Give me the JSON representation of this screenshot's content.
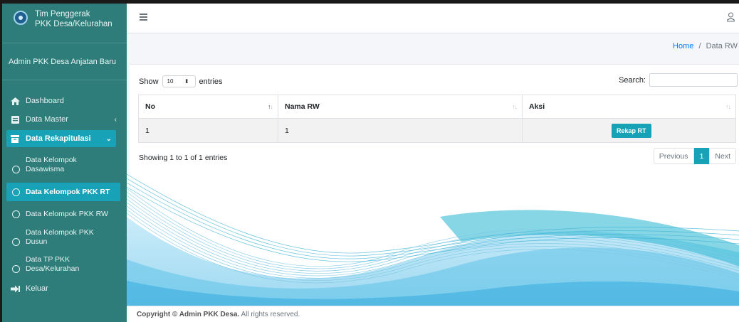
{
  "brand": {
    "line1": "Tim Penggerak",
    "line2": "PKK Desa/Kelurahan"
  },
  "user": {
    "name": "Admin PKK Desa Anjatan Baru"
  },
  "sidebar": {
    "items": [
      {
        "label": "Dashboard",
        "icon": "home-icon"
      },
      {
        "label": "Data Master",
        "icon": "database-icon"
      },
      {
        "label": "Data Rekapitulasi",
        "icon": "archive-icon"
      }
    ],
    "sub": [
      {
        "line1": "Data Kelompok",
        "line2": "Dasawisma"
      },
      {
        "label": "Data Kelompok PKK RT"
      },
      {
        "label": "Data Kelompok PKK RW"
      },
      {
        "line1": "Data Kelompok PKK",
        "line2": "Dusun"
      },
      {
        "line1": "Data TP PKK",
        "line2": "Desa/Kelurahan"
      }
    ],
    "logout": "Keluar"
  },
  "breadcrumb": {
    "home": "Home",
    "sep": "/",
    "current": "Data RW"
  },
  "table_controls": {
    "show_label": "Show",
    "page_size": "10",
    "entries_label": "entries",
    "search_label": "Search:",
    "search_value": ""
  },
  "table": {
    "columns": [
      "No",
      "Nama RW",
      "Aksi"
    ],
    "rows": [
      {
        "no": "1",
        "nama_rw": "1",
        "action": "Rekap RT"
      }
    ],
    "info": "Showing 1 to 1 of 1 entries"
  },
  "pagination": {
    "previous": "Previous",
    "current": "1",
    "next": "Next"
  },
  "footer": {
    "strong": "Copyright © Admin PKK Desa.",
    "rest": " All rights reserved."
  },
  "colors": {
    "sidebar": "#2e7d7a",
    "accent": "#17a2b8",
    "link": "#007bff"
  }
}
